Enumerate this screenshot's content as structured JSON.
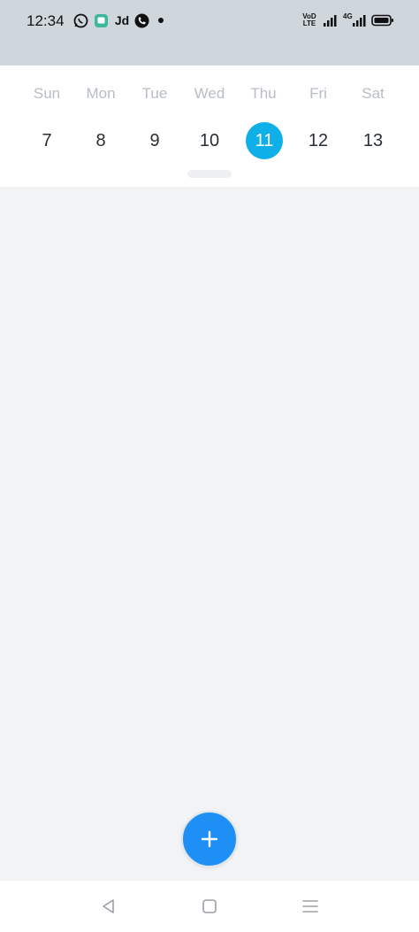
{
  "status_bar": {
    "time": "12:34",
    "app_icon_text": "Jd",
    "volte_line1": "VoD",
    "volte_line2": "LTE",
    "network_label": "4G",
    "icons": [
      "whatsapp-icon",
      "messages-icon",
      "jd-icon",
      "call-icon",
      "dot-icon",
      "volte-icon",
      "signal-icon",
      "signal-4g-icon",
      "battery-icon"
    ]
  },
  "calendar": {
    "days": [
      {
        "name": "Sun",
        "num": "7"
      },
      {
        "name": "Mon",
        "num": "8"
      },
      {
        "name": "Tue",
        "num": "9"
      },
      {
        "name": "Wed",
        "num": "10"
      },
      {
        "name": "Thu",
        "num": "11",
        "selected": true
      },
      {
        "name": "Fri",
        "num": "12"
      },
      {
        "name": "Sat",
        "num": "13"
      }
    ],
    "selected_color": "#0fb0e8"
  },
  "fab": {
    "icon": "plus-icon",
    "color": "#1e8ff5"
  },
  "nav_bar": {
    "buttons": [
      "back-icon",
      "home-icon",
      "menu-icon"
    ]
  }
}
